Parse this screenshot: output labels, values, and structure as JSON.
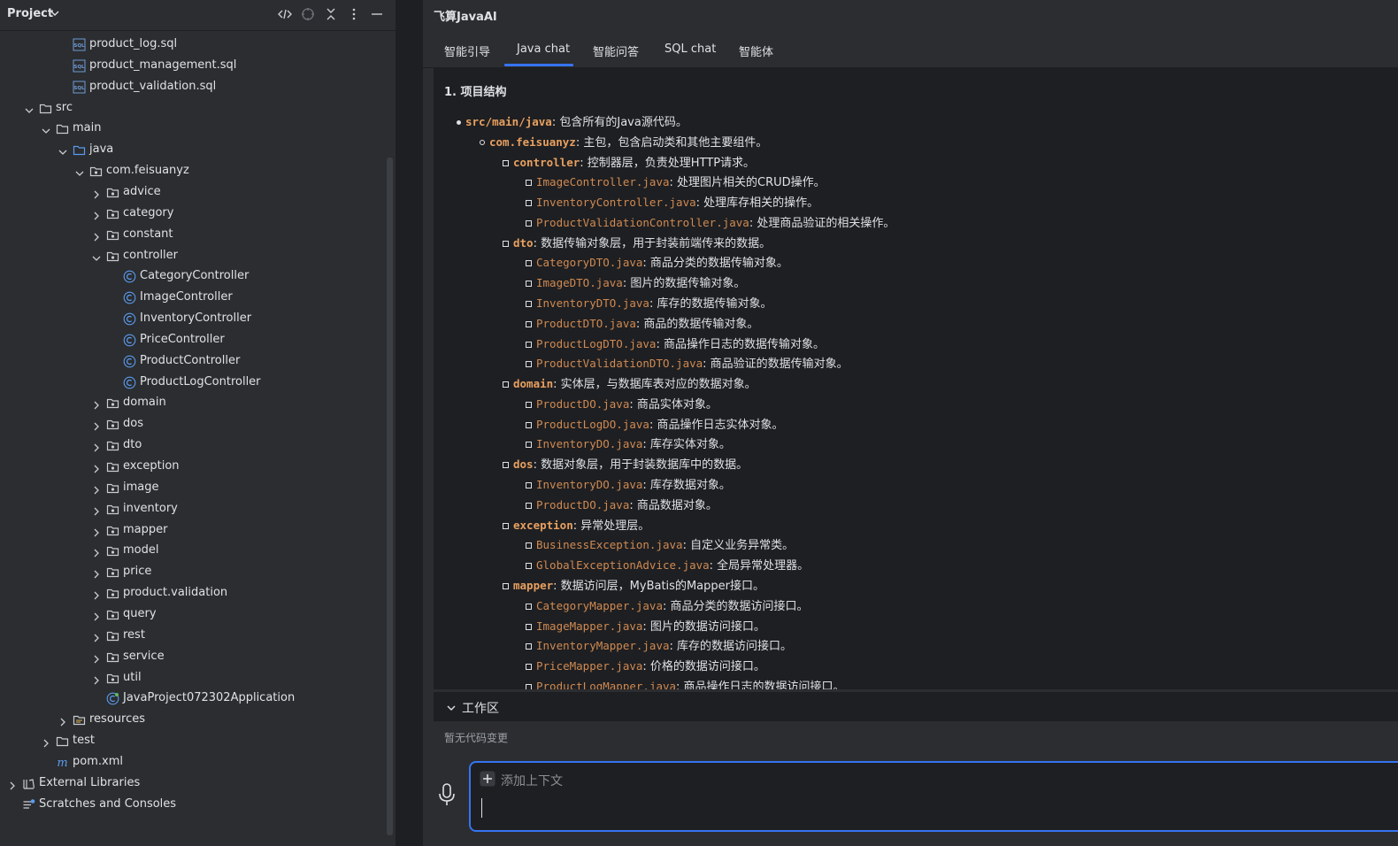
{
  "project_panel": {
    "title": "Project",
    "tree": [
      {
        "label": "product_log.sql",
        "icon": "sql-file-icon",
        "depth": 3,
        "expander": "none"
      },
      {
        "label": "product_management.sql",
        "icon": "sql-file-icon",
        "depth": 3,
        "expander": "none"
      },
      {
        "label": "product_validation.sql",
        "icon": "sql-file-icon",
        "depth": 3,
        "expander": "none"
      },
      {
        "label": "src",
        "icon": "folder-icon",
        "depth": 1,
        "expander": "expanded"
      },
      {
        "label": "main",
        "icon": "folder-icon",
        "depth": 2,
        "expander": "expanded"
      },
      {
        "label": "java",
        "icon": "source-folder-icon",
        "depth": 3,
        "expander": "expanded"
      },
      {
        "label": "com.feisuanyz",
        "icon": "package-icon",
        "depth": 4,
        "expander": "expanded"
      },
      {
        "label": "advice",
        "icon": "package-icon",
        "depth": 5,
        "expander": "collapsed"
      },
      {
        "label": "category",
        "icon": "package-icon",
        "depth": 5,
        "expander": "collapsed"
      },
      {
        "label": "constant",
        "icon": "package-icon",
        "depth": 5,
        "expander": "collapsed"
      },
      {
        "label": "controller",
        "icon": "package-icon",
        "depth": 5,
        "expander": "expanded"
      },
      {
        "label": "CategoryController",
        "icon": "class-icon",
        "depth": 6,
        "expander": "none"
      },
      {
        "label": "ImageController",
        "icon": "class-icon",
        "depth": 6,
        "expander": "none"
      },
      {
        "label": "InventoryController",
        "icon": "class-icon",
        "depth": 6,
        "expander": "none"
      },
      {
        "label": "PriceController",
        "icon": "class-icon",
        "depth": 6,
        "expander": "none"
      },
      {
        "label": "ProductController",
        "icon": "class-icon",
        "depth": 6,
        "expander": "none"
      },
      {
        "label": "ProductLogController",
        "icon": "class-icon",
        "depth": 6,
        "expander": "none"
      },
      {
        "label": "domain",
        "icon": "package-icon",
        "depth": 5,
        "expander": "collapsed"
      },
      {
        "label": "dos",
        "icon": "package-icon",
        "depth": 5,
        "expander": "collapsed"
      },
      {
        "label": "dto",
        "icon": "package-icon",
        "depth": 5,
        "expander": "collapsed"
      },
      {
        "label": "exception",
        "icon": "package-icon",
        "depth": 5,
        "expander": "collapsed"
      },
      {
        "label": "image",
        "icon": "package-icon",
        "depth": 5,
        "expander": "collapsed"
      },
      {
        "label": "inventory",
        "icon": "package-icon",
        "depth": 5,
        "expander": "collapsed"
      },
      {
        "label": "mapper",
        "icon": "package-icon",
        "depth": 5,
        "expander": "collapsed"
      },
      {
        "label": "model",
        "icon": "package-icon",
        "depth": 5,
        "expander": "collapsed"
      },
      {
        "label": "price",
        "icon": "package-icon",
        "depth": 5,
        "expander": "collapsed"
      },
      {
        "label": "product.validation",
        "icon": "package-icon",
        "depth": 5,
        "expander": "collapsed"
      },
      {
        "label": "query",
        "icon": "package-icon",
        "depth": 5,
        "expander": "collapsed"
      },
      {
        "label": "rest",
        "icon": "package-icon",
        "depth": 5,
        "expander": "collapsed"
      },
      {
        "label": "service",
        "icon": "package-icon",
        "depth": 5,
        "expander": "collapsed"
      },
      {
        "label": "util",
        "icon": "package-icon",
        "depth": 5,
        "expander": "collapsed"
      },
      {
        "label": "JavaProject072302Application",
        "icon": "spring-boot-class-icon",
        "depth": 5,
        "expander": "none"
      },
      {
        "label": "resources",
        "icon": "resources-folder-icon",
        "depth": 3,
        "expander": "collapsed"
      },
      {
        "label": "test",
        "icon": "folder-icon",
        "depth": 2,
        "expander": "collapsed"
      },
      {
        "label": "pom.xml",
        "icon": "maven-icon",
        "depth": 2,
        "expander": "none"
      },
      {
        "label": "External Libraries",
        "icon": "libraries-icon",
        "depth": 0,
        "expander": "collapsed"
      },
      {
        "label": "Scratches and Consoles",
        "icon": "scratches-icon",
        "depth": 0,
        "expander": "none"
      }
    ]
  },
  "chat_panel": {
    "title": "飞算JavaAI",
    "tabs": [
      "智能引导",
      "Java chat",
      "智能问答",
      "SQL chat",
      "智能体"
    ],
    "active_tab": "Java chat",
    "section_heading": "1. 项目结构",
    "items": [
      {
        "level": 1,
        "code": "src/main/java",
        "bold": true,
        "desc": ": 包含所有的Java源代码。"
      },
      {
        "level": 2,
        "code": "com.feisuanyz",
        "bold": true,
        "desc": ": 主包，包含启动类和其他主要组件。"
      },
      {
        "level": 3,
        "code": "controller",
        "bold": true,
        "desc": ": 控制器层，负责处理HTTP请求。"
      },
      {
        "level": 4,
        "code": "ImageController.java",
        "bold": false,
        "desc": ": 处理图片相关的CRUD操作。"
      },
      {
        "level": 4,
        "code": "InventoryController.java",
        "bold": false,
        "desc": ": 处理库存相关的操作。"
      },
      {
        "level": 4,
        "code": "ProductValidationController.java",
        "bold": false,
        "desc": ": 处理商品验证的相关操作。"
      },
      {
        "level": 3,
        "code": "dto",
        "bold": true,
        "desc": ": 数据传输对象层，用于封装前端传来的数据。"
      },
      {
        "level": 4,
        "code": "CategoryDTO.java",
        "bold": false,
        "desc": ": 商品分类的数据传输对象。"
      },
      {
        "level": 4,
        "code": "ImageDTO.java",
        "bold": false,
        "desc": ": 图片的数据传输对象。"
      },
      {
        "level": 4,
        "code": "InventoryDTO.java",
        "bold": false,
        "desc": ": 库存的数据传输对象。"
      },
      {
        "level": 4,
        "code": "ProductDTO.java",
        "bold": false,
        "desc": ": 商品的数据传输对象。"
      },
      {
        "level": 4,
        "code": "ProductLogDTO.java",
        "bold": false,
        "desc": ": 商品操作日志的数据传输对象。"
      },
      {
        "level": 4,
        "code": "ProductValidationDTO.java",
        "bold": false,
        "desc": ": 商品验证的数据传输对象。"
      },
      {
        "level": 3,
        "code": "domain",
        "bold": true,
        "desc": ": 实体层，与数据库表对应的数据对象。"
      },
      {
        "level": 4,
        "code": "ProductDO.java",
        "bold": false,
        "desc": ": 商品实体对象。"
      },
      {
        "level": 4,
        "code": "ProductLogDO.java",
        "bold": false,
        "desc": ": 商品操作日志实体对象。"
      },
      {
        "level": 4,
        "code": "InventoryDO.java",
        "bold": false,
        "desc": ": 库存实体对象。"
      },
      {
        "level": 3,
        "code": "dos",
        "bold": true,
        "desc": ": 数据对象层，用于封装数据库中的数据。"
      },
      {
        "level": 4,
        "code": "InventoryDO.java",
        "bold": false,
        "desc": ": 库存数据对象。"
      },
      {
        "level": 4,
        "code": "ProductDO.java",
        "bold": false,
        "desc": ": 商品数据对象。"
      },
      {
        "level": 3,
        "code": "exception",
        "bold": true,
        "desc": ": 异常处理层。"
      },
      {
        "level": 4,
        "code": "BusinessException.java",
        "bold": false,
        "desc": ": 自定义业务异常类。"
      },
      {
        "level": 4,
        "code": "GlobalExceptionAdvice.java",
        "bold": false,
        "desc": ": 全局异常处理器。"
      },
      {
        "level": 3,
        "code": "mapper",
        "bold": true,
        "desc": ": 数据访问层，MyBatis的Mapper接口。"
      },
      {
        "level": 4,
        "code": "CategoryMapper.java",
        "bold": false,
        "desc": ": 商品分类的数据访问接口。"
      },
      {
        "level": 4,
        "code": "ImageMapper.java",
        "bold": false,
        "desc": ": 图片的数据访问接口。"
      },
      {
        "level": 4,
        "code": "InventoryMapper.java",
        "bold": false,
        "desc": ": 库存的数据访问接口。"
      },
      {
        "level": 4,
        "code": "PriceMapper.java",
        "bold": false,
        "desc": ": 价格的数据访问接口。"
      },
      {
        "level": 4,
        "code": "ProductLogMapper.java",
        "bold": false,
        "desc": ": 商品操作日志的数据访问接口。"
      }
    ],
    "workspace": {
      "title": "工作区",
      "status": "暂无代码变更"
    },
    "input": {
      "add_context_label": "添加上下文"
    }
  },
  "colors": {
    "accent": "#3574f0",
    "code_orange": "#d08a52",
    "panel_bg": "#2b2d30",
    "editor_bg": "#1e1f22"
  }
}
